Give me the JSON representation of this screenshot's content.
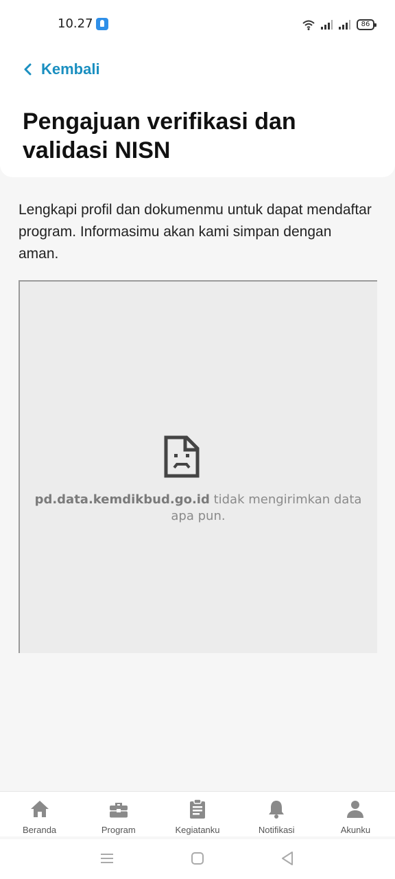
{
  "status_bar": {
    "time": "10.27",
    "battery": "86",
    "icons": [
      "app-notification-icon",
      "wifi-icon",
      "signal-icon",
      "signal-icon",
      "battery-icon"
    ]
  },
  "header": {
    "back_label": "Kembali",
    "title": "Pengajuan verifikasi dan validasi NISN"
  },
  "main": {
    "description": "Lengkapi profil dan dokumenmu untuk dapat mendaftar program. Informasimu akan kami simpan dengan aman.",
    "embed": {
      "domain": "pd.data.kemdikbud.go.id",
      "message": " tidak mengirimkan data apa pun.",
      "icon": "sad-document-icon"
    }
  },
  "bottom_nav": {
    "items": [
      {
        "label": "Beranda",
        "icon": "home-icon"
      },
      {
        "label": "Program",
        "icon": "briefcase-icon"
      },
      {
        "label": "Kegiatanku",
        "icon": "clipboard-icon"
      },
      {
        "label": "Notifikasi",
        "icon": "bell-icon"
      },
      {
        "label": "Akunku",
        "icon": "user-icon"
      }
    ]
  },
  "system_nav": [
    "menu-icon",
    "home-square-icon",
    "back-triangle-icon"
  ],
  "colors": {
    "accent": "#1a8fc0",
    "nav_icon": "#8a8a8a",
    "background": "#f6f6f6"
  }
}
